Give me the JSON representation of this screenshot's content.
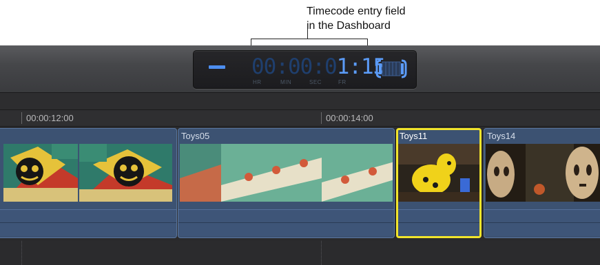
{
  "annotation": {
    "line1": "Timecode entry field",
    "line2": "in the Dashboard"
  },
  "dashboard": {
    "sign_icon": "minus-icon",
    "timecode_dim": "00:00:0",
    "timecode_lit": "1:15",
    "units": {
      "hr": "HR",
      "min": "MIN",
      "sec": "SEC",
      "fr": "FR"
    },
    "clip_icon": "filmstrip-clip-icon",
    "accent_color": "#5b9bf7"
  },
  "ruler": {
    "marks": [
      "00:00:12:00",
      "00:00:14:00"
    ]
  },
  "timeline": {
    "clips": [
      {
        "name": ""
      },
      {
        "name": "Toys05"
      },
      {
        "name": "Toys11",
        "selected": true
      },
      {
        "name": "Toys14"
      }
    ],
    "selection_color": "#f2e52b",
    "clip_color": "#3c5272"
  }
}
